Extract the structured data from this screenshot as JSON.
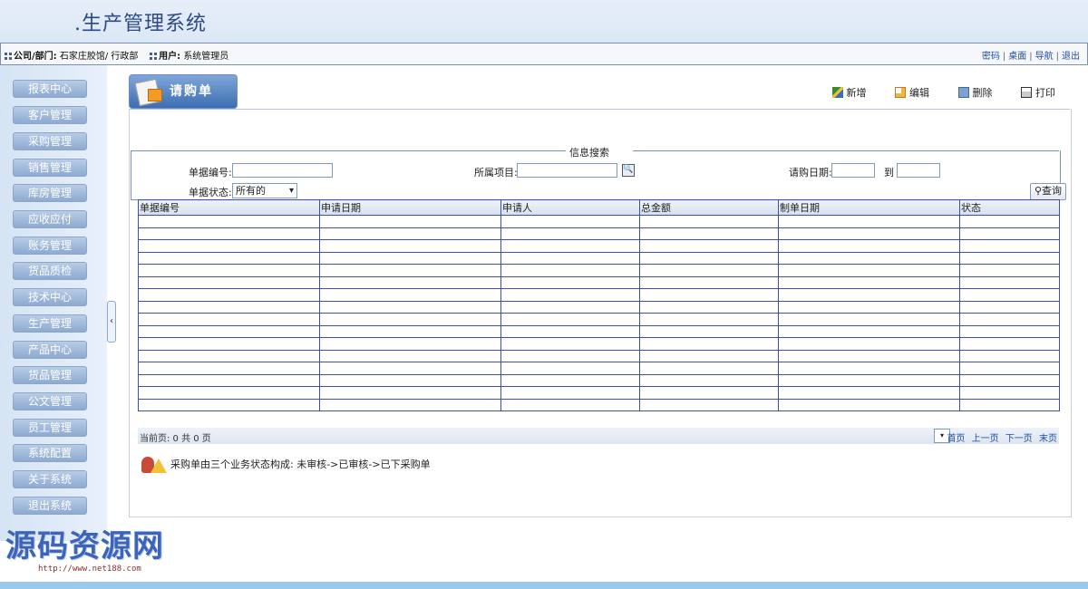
{
  "app": {
    "title": ".生产管理系统"
  },
  "infobar": {
    "company_label": "公司/部门:",
    "company_value": "石家庄胶馆/ 行政部",
    "user_label": "用户:",
    "user_value": "系统管理员",
    "links": [
      "密码",
      "桌面",
      "导航",
      "退出"
    ]
  },
  "sidebar": {
    "items": [
      "报表中心",
      "客户管理",
      "采购管理",
      "销售管理",
      "库房管理",
      "应收应付",
      "账务管理",
      "货品质检",
      "技术中心",
      "生产管理",
      "产品中心",
      "货品管理",
      "公文管理",
      "员工管理",
      "系统配置",
      "关于系统",
      "退出系统"
    ]
  },
  "page": {
    "tab_title": "请购单",
    "toolbar": {
      "add": "新增",
      "edit": "编辑",
      "delete": "删除",
      "print": "打印"
    }
  },
  "search": {
    "legend": "信息搜索",
    "doc_no_label": "单据编号:",
    "project_label": "所属项目:",
    "date_label": "请购日期:",
    "date_to": "到",
    "status_label": "单据状态:",
    "status_value": "所有的",
    "query_button": "查询"
  },
  "table": {
    "columns": [
      "单据编号",
      "申请日期",
      "申请人",
      "总金额",
      "制单日期",
      "状态"
    ],
    "empty_rows": 16
  },
  "pager": {
    "info": "当前页: 0 共 0 页",
    "nav": [
      "首页",
      "上一页",
      "下一页",
      "末页"
    ]
  },
  "note": {
    "text": "采购单由三个业务状态构成: 未审核->已审核->已下采购单"
  },
  "watermark": {
    "title": "源码资源网",
    "url": "http://www.net188.com"
  }
}
